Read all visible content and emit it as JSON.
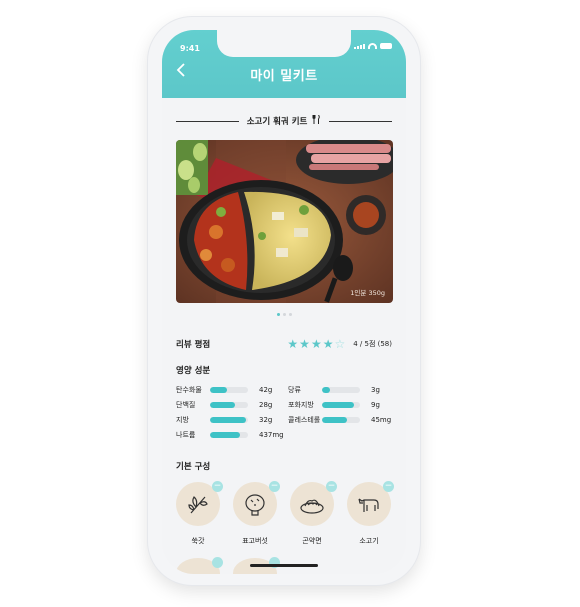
{
  "status_bar": {
    "time": "9:41"
  },
  "header": {
    "title": "마이 밀키트",
    "back_icon": "chevron-left-icon"
  },
  "kit": {
    "title": "소고기 훠궈 키트",
    "title_icon": "fork-knife-icon",
    "servings": "1인분 350g",
    "carousel": {
      "pages": 3,
      "current": 1
    }
  },
  "review": {
    "label": "리뷰 평점",
    "rating": 4,
    "max": 5,
    "score_text": "4 / 5점 (58)"
  },
  "nutrition": {
    "title": "영양 성분",
    "items": [
      {
        "name": "탄수화물",
        "value": "42g",
        "level": 0.45
      },
      {
        "name": "당류",
        "value": "3g",
        "level": 0.2
      },
      {
        "name": "단백질",
        "value": "28g",
        "level": 0.65
      },
      {
        "name": "포화지방",
        "value": "9g",
        "level": 0.85
      },
      {
        "name": "지방",
        "value": "32g",
        "level": 0.95
      },
      {
        "name": "콜레스테롤",
        "value": "45mg",
        "level": 0.65
      },
      {
        "name": "나트륨",
        "value": "437mg",
        "level": 0.8
      }
    ]
  },
  "components": {
    "title": "기본 구성",
    "items": [
      {
        "name": "쑥갓",
        "icon": "herb-icon"
      },
      {
        "name": "표고버섯",
        "icon": "mushroom-icon"
      },
      {
        "name": "곤약면",
        "icon": "noodle-icon"
      },
      {
        "name": "소고기",
        "icon": "cow-icon"
      }
    ]
  },
  "colors": {
    "accent": "#5cc7c9",
    "bar": "#3ec2c6",
    "ingredient_bg": "#ede3d4"
  }
}
